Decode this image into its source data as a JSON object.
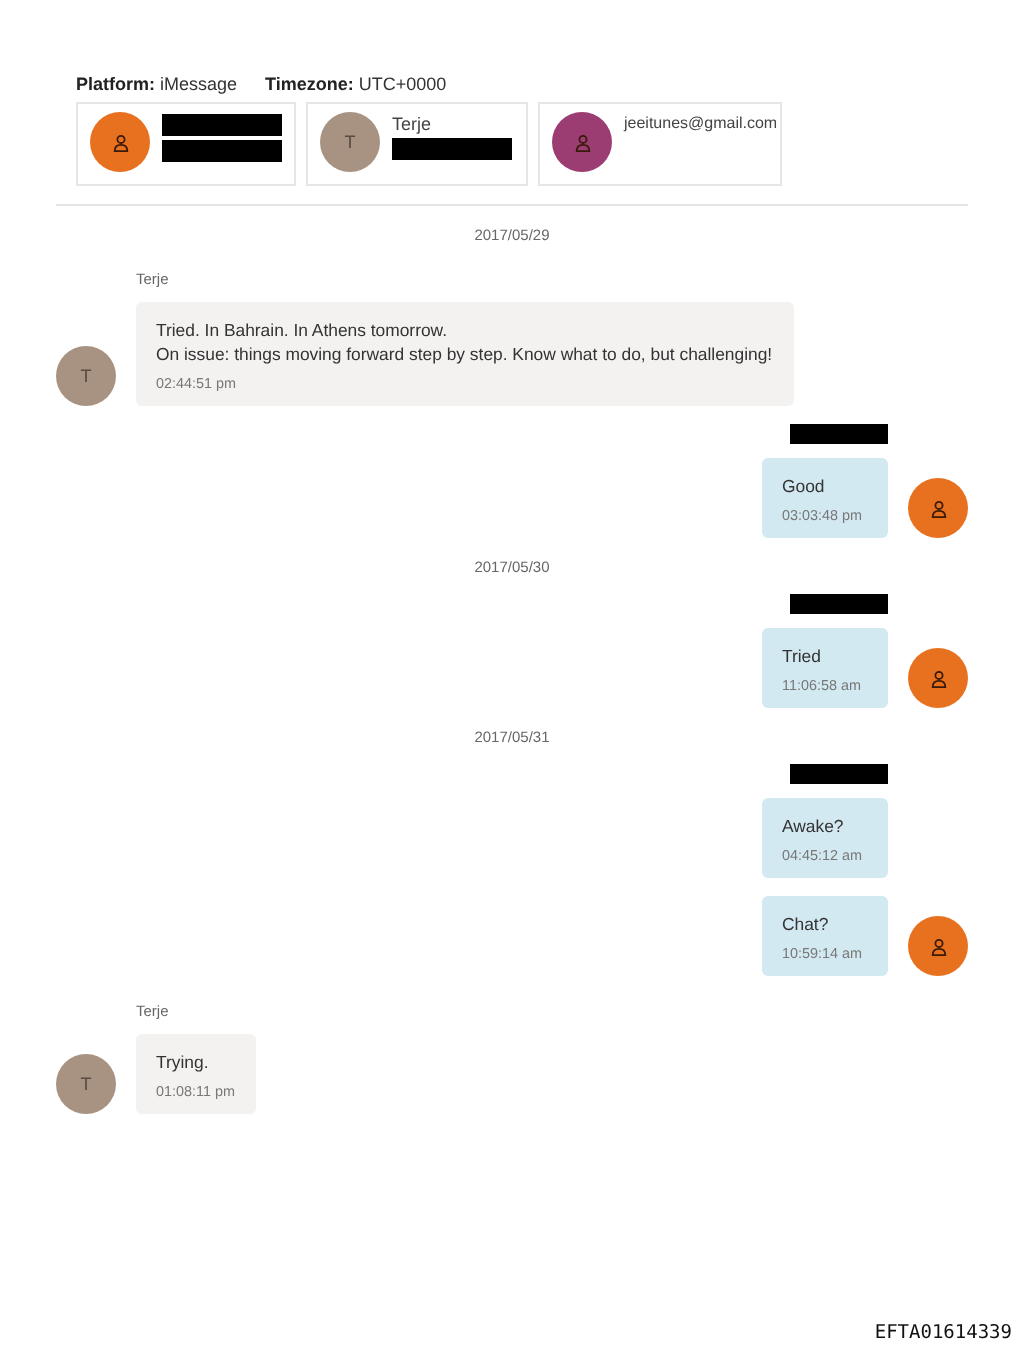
{
  "header": {
    "platform_label": "Platform:",
    "platform": "iMessage",
    "timezone_label": "Timezone:",
    "timezone": "UTC+0000"
  },
  "participants": [
    {
      "avatar": {
        "kind": "icon",
        "color": "#e8711f"
      },
      "lines": [
        {
          "kind": "redacted"
        },
        {
          "kind": "redacted"
        }
      ]
    },
    {
      "avatar": {
        "kind": "initial",
        "text": "T",
        "color": "#a89282"
      },
      "lines": [
        {
          "kind": "text",
          "text": "Terje"
        },
        {
          "kind": "redacted"
        }
      ]
    },
    {
      "avatar": {
        "kind": "icon",
        "color": "#9b3d72"
      },
      "lines": [
        {
          "kind": "text",
          "text": "jeeitunes@gmail.com"
        }
      ]
    }
  ],
  "conversation": [
    {
      "kind": "date",
      "text": "2017/05/29"
    },
    {
      "kind": "incoming",
      "sender": {
        "kind": "text",
        "text": "Terje"
      },
      "avatar": {
        "kind": "initial",
        "text": "T",
        "color": "#a89282"
      },
      "messages": [
        {
          "text": "Tried. In Bahrain. In Athens tomorrow.\nOn issue: things moving forward step by step. Know what to do, but challenging!",
          "time": "02:44:51 pm"
        }
      ]
    },
    {
      "kind": "outgoing",
      "sender": {
        "kind": "redacted"
      },
      "avatar": {
        "kind": "icon",
        "color": "#e8711f"
      },
      "messages": [
        {
          "text": "Good",
          "time": "03:03:48 pm"
        }
      ]
    },
    {
      "kind": "date",
      "text": "2017/05/30"
    },
    {
      "kind": "outgoing",
      "sender": {
        "kind": "redacted"
      },
      "avatar": {
        "kind": "icon",
        "color": "#e8711f"
      },
      "messages": [
        {
          "text": "Tried",
          "time": "11:06:58 am"
        }
      ]
    },
    {
      "kind": "date",
      "text": "2017/05/31"
    },
    {
      "kind": "outgoing",
      "sender": {
        "kind": "redacted"
      },
      "avatar": {
        "kind": "icon",
        "color": "#e8711f"
      },
      "messages": [
        {
          "text": "Awake?",
          "time": "04:45:12 am"
        },
        {
          "text": "Chat?",
          "time": "10:59:14 am"
        }
      ]
    },
    {
      "kind": "incoming",
      "sender": {
        "kind": "text",
        "text": "Terje"
      },
      "avatar": {
        "kind": "initial",
        "text": "T",
        "color": "#a89282"
      },
      "messages": [
        {
          "text": "Trying.",
          "time": "01:08:11 pm"
        }
      ]
    }
  ],
  "stamp": "EFTA01614339"
}
